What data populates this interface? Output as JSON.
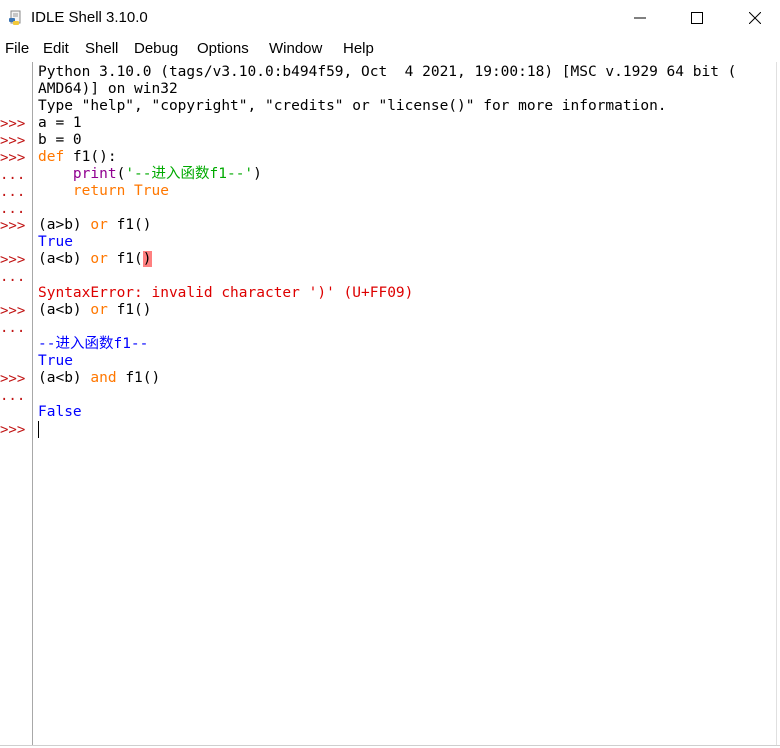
{
  "window": {
    "title": "IDLE Shell 3.10.0"
  },
  "menu": [
    "File",
    "Edit",
    "Shell",
    "Debug",
    "Options",
    "Window",
    "Help"
  ],
  "gutter": [
    {
      "line": 4,
      "text": ">>>"
    },
    {
      "line": 5,
      "text": ">>>"
    },
    {
      "line": 6,
      "text": ">>>"
    },
    {
      "line": 7,
      "text": "..."
    },
    {
      "line": 8,
      "text": "..."
    },
    {
      "line": 9,
      "text": "..."
    },
    {
      "line": 10,
      "text": ">>>"
    },
    {
      "line": 12,
      "text": ">>>"
    },
    {
      "line": 13,
      "text": "..."
    },
    {
      "line": 15,
      "text": ">>>"
    },
    {
      "line": 16,
      "text": "..."
    },
    {
      "line": 19,
      "text": ">>>"
    },
    {
      "line": 20,
      "text": "..."
    },
    {
      "line": 22,
      "text": ">>>"
    }
  ],
  "shell": {
    "banner1": "Python 3.10.0 (tags/v3.10.0:b494f59, Oct  4 2021, 19:00:18) [MSC v.1929 64 bit (",
    "banner2": "AMD64)] on win32",
    "banner3": "Type \"help\", \"copyright\", \"credits\" or \"license()\" for more information.",
    "l4": "a = 1",
    "l5": "b = 0",
    "l6_kw": "def",
    "l6_rest": " f1():",
    "l7_indent": "    ",
    "l7_builtin": "print",
    "l7_paren_open": "(",
    "l7_str": "'--进入函数f1--'",
    "l7_paren_close": ")",
    "l8_indent": "    ",
    "l8_kw": "return",
    "l8_sp": " ",
    "l8_true": "True",
    "l10_a": "(a>b) ",
    "l10_kw": "or",
    "l10_b": " f1()",
    "l11": "True",
    "l12_a": "(a<b) ",
    "l12_kw": "or",
    "l12_b": " f1(",
    "l12_bad": ")",
    "l14": "SyntaxError: invalid character ')' (U+FF09)",
    "l15_a": "(a<b) ",
    "l15_kw": "or",
    "l15_b": " f1()",
    "l17": "--进入函数f1--",
    "l18": "True",
    "l19_a": "(a<b) ",
    "l19_kw": "and",
    "l19_b": " f1()",
    "l21": "False"
  },
  "colors": {
    "prompt": "#c11515",
    "keyword": "#ff7700",
    "builtin": "#900090",
    "string": "#00aa00",
    "output": "#0000ff",
    "error": "#dd0000",
    "error_highlight": "#ff8080"
  }
}
